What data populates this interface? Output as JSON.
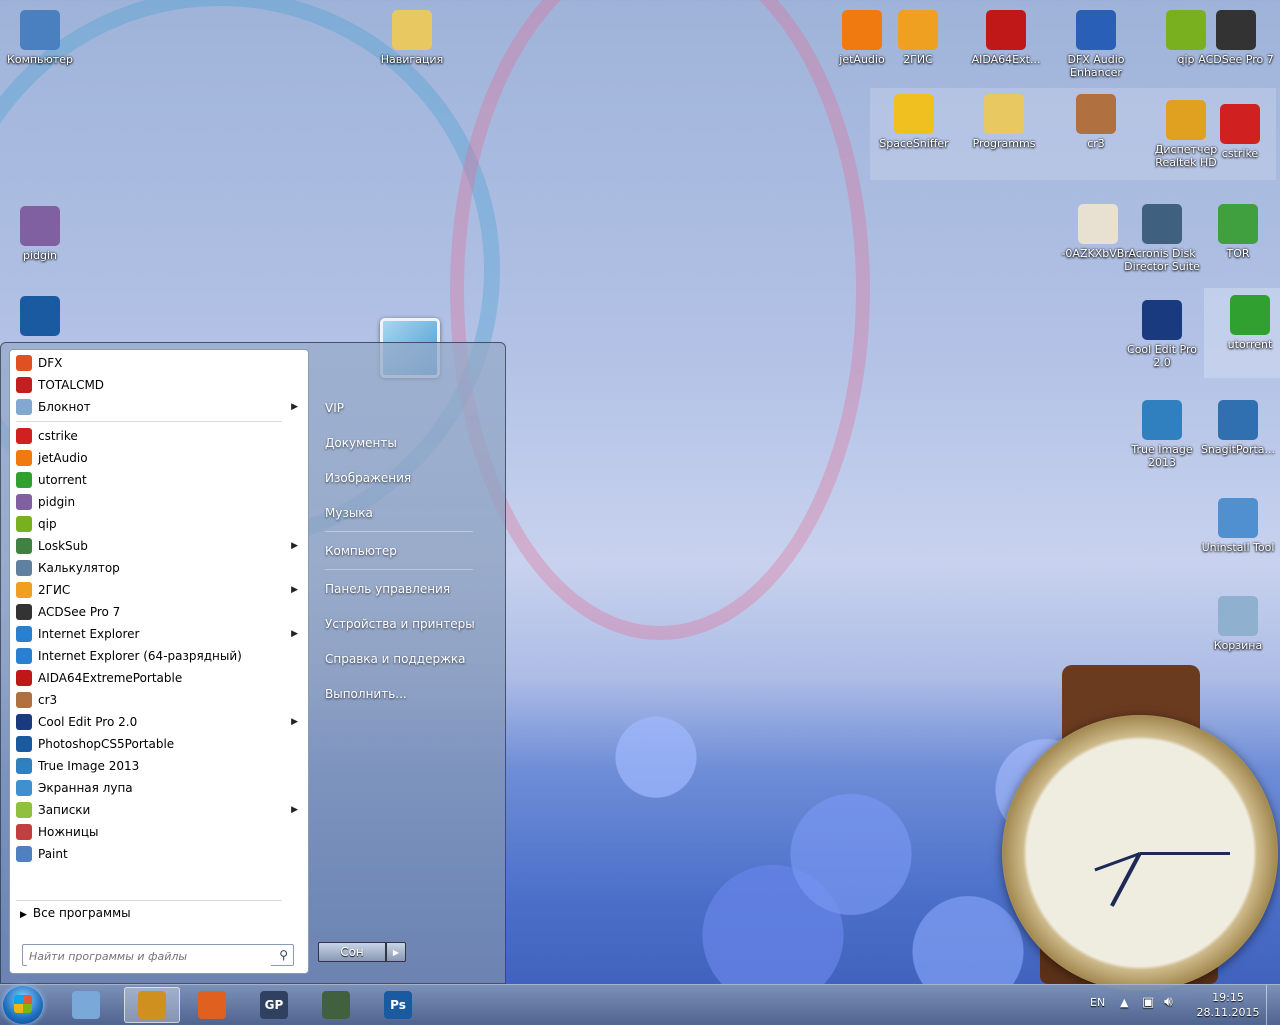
{
  "desktop_icons": [
    {
      "label": "Компьютер",
      "icon": "computer-icon",
      "color": "#4a7fc0"
    },
    {
      "label": "Навигация",
      "icon": "folder-icon",
      "color": "#e8c860"
    },
    {
      "label": "jetAudio",
      "icon": "jetaudio-icon",
      "color": "#f07a10"
    },
    {
      "label": "2ГИС",
      "icon": "2gis-icon",
      "color": "#f0a020"
    },
    {
      "label": "AIDA64Ext...",
      "icon": "aida64-icon",
      "color": "#c01818"
    },
    {
      "label": "DFX Audio Enhancer",
      "icon": "dfx-icon",
      "color": "#2a5fb8"
    },
    {
      "label": "qip",
      "icon": "qip-icon",
      "color": "#78b020"
    },
    {
      "label": "ACDSee Pro 7",
      "icon": "camera-icon",
      "color": "#333333"
    },
    {
      "label": "SpaceSniffer",
      "icon": "puzzle-icon",
      "color": "#f0c020"
    },
    {
      "label": "Programms",
      "icon": "folder-icon",
      "color": "#e8c860"
    },
    {
      "label": "cr3",
      "icon": "book-icon",
      "color": "#b07040"
    },
    {
      "label": "Диспетчер Realtek HD",
      "icon": "realtek-icon",
      "color": "#e0a020"
    },
    {
      "label": "cstrike",
      "icon": "cstrike-icon",
      "color": "#d02020"
    },
    {
      "label": "-0AZKXbVBrs",
      "icon": "spreadsheet-icon",
      "color": "#e8e0d0"
    },
    {
      "label": "Acronis Disk Director Suite",
      "icon": "acronis-icon",
      "color": "#406080"
    },
    {
      "label": "TOR",
      "icon": "tor-icon",
      "color": "#40a040"
    },
    {
      "label": "pidgin",
      "icon": "pidgin-icon",
      "color": "#8060a0"
    },
    {
      "label": "Cool Edit Pro 2.0",
      "icon": "cooledit-icon",
      "color": "#1a3a80"
    },
    {
      "label": "utorrent",
      "icon": "utorrent-icon",
      "color": "#30a030"
    },
    {
      "label": "True Image 2013",
      "icon": "trueimage-icon",
      "color": "#3080c0"
    },
    {
      "label": "SnagitPorta...",
      "icon": "snagit-icon",
      "color": "#3070b0"
    },
    {
      "label": "Uninstall Tool",
      "icon": "uninstall-icon",
      "color": "#5090d0"
    },
    {
      "label": "Корзина",
      "icon": "recycle-bin-icon",
      "color": "#90b0d0"
    }
  ],
  "start_menu": {
    "programs": [
      {
        "label": "DFX",
        "icon": "dfx-icon",
        "color": "#e05020",
        "submenu": false
      },
      {
        "label": "TOTALCMD",
        "icon": "totalcmd-icon",
        "color": "#c02020",
        "submenu": false
      },
      {
        "label": "Блокнот",
        "icon": "notepad-icon",
        "color": "#80a8d0",
        "submenu": true
      },
      {
        "label": "cstrike",
        "icon": "cstrike-icon",
        "color": "#d02020",
        "submenu": false
      },
      {
        "label": "jetAudio",
        "icon": "jetaudio-icon",
        "color": "#f07a10",
        "submenu": false
      },
      {
        "label": "utorrent",
        "icon": "utorrent-icon",
        "color": "#30a030",
        "submenu": false
      },
      {
        "label": "pidgin",
        "icon": "pidgin-icon",
        "color": "#8060a0",
        "submenu": false
      },
      {
        "label": "qip",
        "icon": "qip-icon",
        "color": "#78b020",
        "submenu": false
      },
      {
        "label": "LoskSub",
        "icon": "losksub-icon",
        "color": "#408040",
        "submenu": true
      },
      {
        "label": "Калькулятор",
        "icon": "calculator-icon",
        "color": "#6080a0",
        "submenu": false
      },
      {
        "label": "2ГИС",
        "icon": "2gis-icon",
        "color": "#f0a020",
        "submenu": true
      },
      {
        "label": "ACDSee Pro 7",
        "icon": "camera-icon",
        "color": "#333333",
        "submenu": false
      },
      {
        "label": "Internet Explorer",
        "icon": "ie-icon",
        "color": "#2a80d0",
        "submenu": true
      },
      {
        "label": "Internet Explorer (64-разрядный)",
        "icon": "ie-icon",
        "color": "#2a80d0",
        "submenu": false
      },
      {
        "label": "AIDA64ExtremePortable",
        "icon": "aida64-icon",
        "color": "#c01818",
        "submenu": false
      },
      {
        "label": "cr3",
        "icon": "book-icon",
        "color": "#b07040",
        "submenu": false
      },
      {
        "label": "Cool Edit Pro 2.0",
        "icon": "cooledit-icon",
        "color": "#1a3a80",
        "submenu": true
      },
      {
        "label": "PhotoshopCS5Portable",
        "icon": "photoshop-icon",
        "color": "#1a5aa0",
        "submenu": false
      },
      {
        "label": "True Image 2013",
        "icon": "trueimage-icon",
        "color": "#3080c0",
        "submenu": false
      },
      {
        "label": "Экранная лупа",
        "icon": "magnifier-icon",
        "color": "#4090d0",
        "submenu": false
      },
      {
        "label": "Записки",
        "icon": "sticky-notes-icon",
        "color": "#90c040",
        "submenu": true
      },
      {
        "label": "Ножницы",
        "icon": "scissors-icon",
        "color": "#c04040",
        "submenu": false
      },
      {
        "label": "Paint",
        "icon": "paint-icon",
        "color": "#5080c0",
        "submenu": false
      }
    ],
    "all_programs": "Все программы",
    "search_placeholder": "Найти программы и файлы",
    "right_items": [
      "VIP",
      "Документы",
      "Изображения",
      "Музыка",
      "Компьютер",
      "Панель управления",
      "Устройства и принтеры",
      "Справка и поддержка",
      "Выполнить..."
    ],
    "sleep_label": "Сон"
  },
  "taskbar": {
    "language": "EN",
    "time": "19:15",
    "date": "28.11.2015",
    "apps": [
      {
        "name": "explorer-app",
        "icon": "notepad-icon",
        "color": "#7aa8d8",
        "label": "",
        "active": false
      },
      {
        "name": "winamp-app",
        "icon": "winamp-icon",
        "color": "#d09020",
        "label": "",
        "active": true
      },
      {
        "name": "firefox-app",
        "icon": "firefox-icon",
        "color": "#e06020",
        "label": "",
        "active": false
      },
      {
        "name": "gp-app",
        "icon": "gp-icon",
        "color": "#304060",
        "label": "GP",
        "active": false
      },
      {
        "name": "monitor-app",
        "icon": "monitor-icon",
        "color": "#406040",
        "label": "",
        "active": false
      },
      {
        "name": "photoshop-app",
        "icon": "photoshop-icon",
        "color": "#1a5aa0",
        "label": "Ps",
        "active": false
      }
    ]
  },
  "gadget": {
    "type": "clock"
  }
}
